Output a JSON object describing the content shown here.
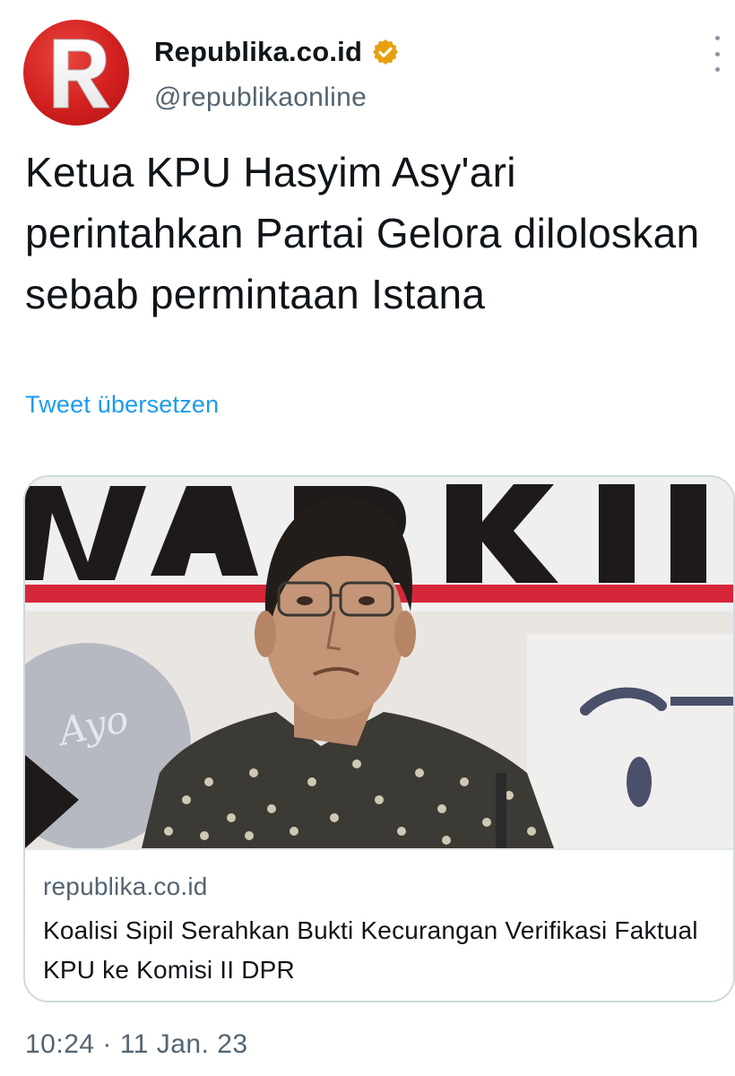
{
  "author": {
    "display_name": "Republika.co.id",
    "handle": "@republikaonline",
    "avatar_letter": "R",
    "verified": true,
    "verified_color": "#e8a010"
  },
  "tweet": {
    "text": "Ketua KPU Hasyim Asy'ari perintahkan Partai Gelora diloloskan sebab permintaan Istana",
    "translate_label": "Tweet übersetzen",
    "timestamp": "10:24 · 11 Jan. 23"
  },
  "link_card": {
    "domain": "republika.co.id",
    "title": "Koalisi Sipil Serahkan Bukti Kecurangan Verifikasi Faktual KPU ke Komisi II DPR"
  },
  "colors": {
    "accent": "#1d9bf0",
    "brand_red": "#d21f1f",
    "secondary_text": "#536471"
  }
}
